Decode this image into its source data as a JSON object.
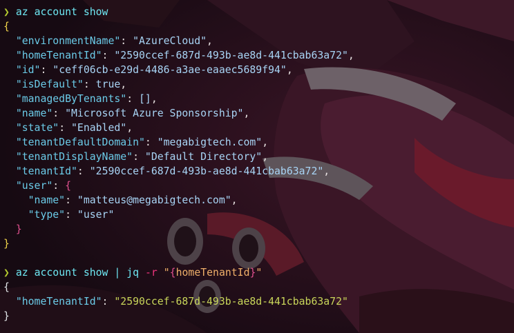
{
  "terminal": {
    "prompt_symbol": "❯",
    "command1": {
      "text": "az account show"
    },
    "output1": {
      "open": "{",
      "close": "}",
      "fields": [
        {
          "key": "\"environmentName\"",
          "value": "\"AzureCloud\"",
          "trail": ","
        },
        {
          "key": "\"homeTenantId\"",
          "value": "\"2590ccef-687d-493b-ae8d-441cbab63a72\"",
          "trail": ","
        },
        {
          "key": "\"id\"",
          "value": "\"ceff06cb-e29d-4486-a3ae-eaaec5689f94\"",
          "trail": ","
        },
        {
          "key": "\"isDefault\"",
          "value": "true",
          "trail": ","
        },
        {
          "key": "\"managedByTenants\"",
          "value": "[]",
          "trail": ","
        },
        {
          "key": "\"name\"",
          "value": "\"Microsoft Azure Sponsorship\"",
          "trail": ","
        },
        {
          "key": "\"state\"",
          "value": "\"Enabled\"",
          "trail": ","
        },
        {
          "key": "\"tenantDefaultDomain\"",
          "value": "\"megabigtech.com\"",
          "trail": ","
        },
        {
          "key": "\"tenantDisplayName\"",
          "value": "\"Default Directory\"",
          "trail": ","
        },
        {
          "key": "\"tenantId\"",
          "value": "\"2590ccef-687d-493b-ae8d-441cbab63a72\"",
          "trail": ","
        }
      ],
      "user": {
        "key": "\"user\"",
        "open": "{",
        "close": "}",
        "fields": [
          {
            "key": "\"name\"",
            "value": "\"matteus@megabigtech.com\"",
            "trail": ","
          },
          {
            "key": "\"type\"",
            "value": "\"user\"",
            "trail": ""
          }
        ]
      }
    },
    "command2": {
      "cmd": "az account show",
      "pipe": "|",
      "tool": "jq",
      "flag": "-r",
      "filter_quote_open": "\"",
      "filter_brace_open": "{",
      "filter_text": "homeTenantId",
      "filter_brace_close": "}",
      "filter_quote_close": "\""
    },
    "output2": {
      "open": "{",
      "close": "}",
      "key": "\"homeTenantId\"",
      "value": "\"2590ccef-687d-493b-ae8d-441cbab63a72\""
    }
  },
  "colors": {
    "background": "#1a0d15",
    "prompt": "#b3c92f",
    "command": "#6ee7f2",
    "flag": "#f0357d",
    "json_key": "#6bcbe8",
    "json_value": "#a8d4f5",
    "jq_value": "#c9d65a"
  }
}
